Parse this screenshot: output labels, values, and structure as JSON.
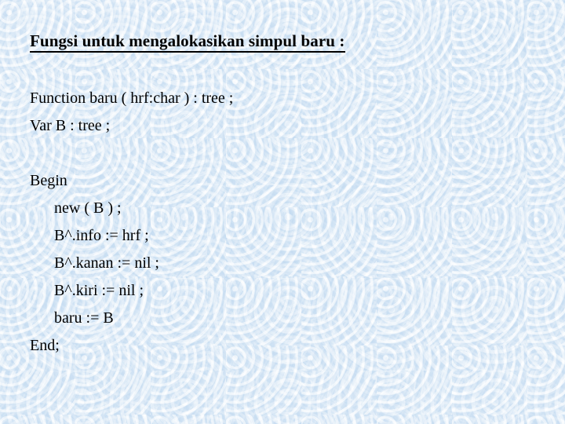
{
  "slide": {
    "title": "Fungsi untuk mengalokasikan simpul baru :",
    "background_color": "#deebf8",
    "text_color": "#000000",
    "code_lines": [
      {
        "text": "Function baru ( hrf:char ) : tree ;",
        "indent": 0
      },
      {
        "text": "Var B : tree ;",
        "indent": 0
      },
      {
        "text": "",
        "indent": 0
      },
      {
        "text": "Begin",
        "indent": 0
      },
      {
        "text": "new ( B ) ;",
        "indent": 1
      },
      {
        "text": "B^.info := hrf ;",
        "indent": 1
      },
      {
        "text": "B^.kanan := nil ;",
        "indent": 1
      },
      {
        "text": "B^.kiri := nil ;",
        "indent": 1
      },
      {
        "text": "baru := B",
        "indent": 1
      },
      {
        "text": "End;",
        "indent": 0
      }
    ]
  }
}
